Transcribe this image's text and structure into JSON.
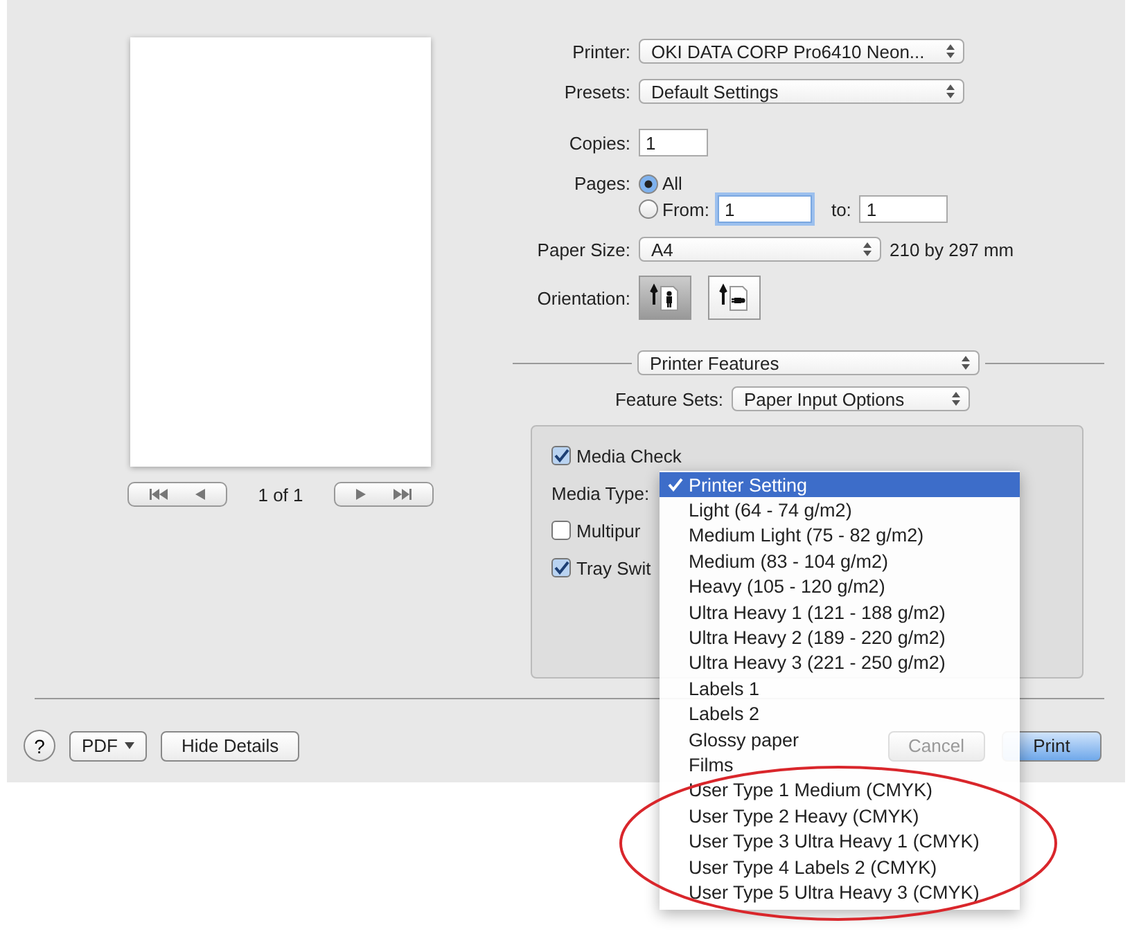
{
  "preview": {
    "page_indicator": "1 of 1"
  },
  "printer": {
    "label": "Printer:",
    "value": "OKI DATA CORP Pro6410 Neon..."
  },
  "presets": {
    "label": "Presets:",
    "value": "Default Settings"
  },
  "copies": {
    "label": "Copies:",
    "value": "1"
  },
  "pages": {
    "label": "Pages:",
    "options": [
      {
        "label": "All",
        "selected": true
      },
      {
        "label": "From:",
        "selected": false
      }
    ],
    "from": "1",
    "to_label": "to:",
    "to": "1"
  },
  "paper_size": {
    "label": "Paper Size:",
    "value": "A4",
    "dimensions": "210 by 297 mm"
  },
  "orientation": {
    "label": "Orientation:",
    "options": [
      {
        "kind": "portrait",
        "selected": true
      },
      {
        "kind": "landscape",
        "selected": false
      }
    ]
  },
  "section_menu": {
    "value": "Printer Features"
  },
  "feature_sets": {
    "label": "Feature Sets:",
    "value": "Paper Input Options"
  },
  "options": [
    {
      "kind": "checkbox",
      "label": "Media Check",
      "checked": true
    },
    {
      "kind": "menu",
      "label": "Media Type:"
    },
    {
      "kind": "checkbox",
      "label": "Multipur",
      "checked": false
    },
    {
      "kind": "checkbox",
      "label": "Tray Swit",
      "checked": true
    }
  ],
  "media_menu": [
    {
      "label": "Printer Setting",
      "selected": true
    },
    {
      "label": "Light (64 - 74 g/m2)",
      "selected": false
    },
    {
      "label": "Medium Light (75 - 82 g/m2)",
      "selected": false
    },
    {
      "label": "Medium (83 - 104 g/m2)",
      "selected": false
    },
    {
      "label": "Heavy (105 - 120 g/m2)",
      "selected": false
    },
    {
      "label": "Ultra Heavy 1 (121 - 188 g/m2)",
      "selected": false
    },
    {
      "label": "Ultra Heavy 2 (189 - 220 g/m2)",
      "selected": false
    },
    {
      "label": "Ultra Heavy 3 (221 - 250 g/m2)",
      "selected": false
    },
    {
      "label": "Labels 1",
      "selected": false
    },
    {
      "label": "Labels 2",
      "selected": false
    },
    {
      "label": "Glossy paper",
      "selected": false
    },
    {
      "label": "Films",
      "selected": false
    },
    {
      "label": "User Type 1 Medium (CMYK)",
      "selected": false
    },
    {
      "label": "User Type 2 Heavy (CMYK)",
      "selected": false
    },
    {
      "label": "User Type 3 Ultra Heavy 1 (CMYK)",
      "selected": false
    },
    {
      "label": "User Type 4 Labels 2 (CMYK)",
      "selected": false
    },
    {
      "label": "User Type 5 Ultra Heavy 3 (CMYK)",
      "selected": false
    }
  ],
  "footer": {
    "help": "?",
    "pdf": "PDF",
    "hide_details": "Hide Details",
    "cancel": {
      "label": "Cancel",
      "disabled": true
    },
    "print": "Print"
  }
}
